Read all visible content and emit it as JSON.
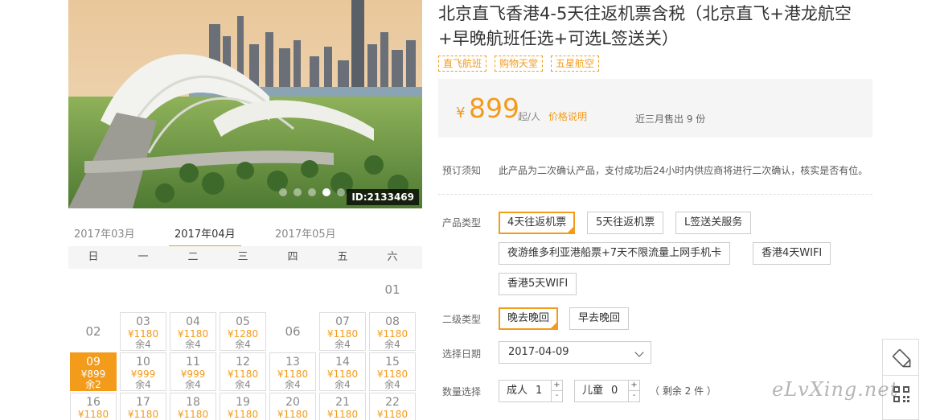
{
  "hero": {
    "image_id": "ID:2133469",
    "carousel_dots": 5,
    "active_dot": 4
  },
  "calendar": {
    "months": [
      "2017年03月",
      "2017年04月",
      "2017年05月"
    ],
    "active_month": "2017年04月",
    "weekdays": [
      "日",
      "一",
      "二",
      "三",
      "四",
      "五",
      "六"
    ],
    "weeks": [
      [
        {
          "d": ""
        },
        {
          "d": ""
        },
        {
          "d": ""
        },
        {
          "d": ""
        },
        {
          "d": ""
        },
        {
          "d": ""
        },
        {
          "d": "01"
        }
      ],
      [
        {
          "d": "02"
        },
        {
          "d": "03",
          "p": "¥1180",
          "r": "余4"
        },
        {
          "d": "04",
          "p": "¥1180",
          "r": "余4"
        },
        {
          "d": "05",
          "p": "¥1280",
          "r": "余4"
        },
        {
          "d": "06"
        },
        {
          "d": "07",
          "p": "¥1180",
          "r": "余4"
        },
        {
          "d": "08",
          "p": "¥1180",
          "r": "余4"
        }
      ],
      [
        {
          "d": "09",
          "p": "¥899",
          "r": "余2",
          "selected": true
        },
        {
          "d": "10",
          "p": "¥999",
          "r": "余4"
        },
        {
          "d": "11",
          "p": "¥999",
          "r": "余4"
        },
        {
          "d": "12",
          "p": "¥1180",
          "r": "余4"
        },
        {
          "d": "13",
          "p": "¥1180",
          "r": "余4"
        },
        {
          "d": "14",
          "p": "¥1180",
          "r": "余4"
        },
        {
          "d": "15",
          "p": "¥1180",
          "r": "余4"
        }
      ],
      [
        {
          "d": "16",
          "p": "¥1180"
        },
        {
          "d": "17",
          "p": "¥1180"
        },
        {
          "d": "18",
          "p": "¥1180"
        },
        {
          "d": "19",
          "p": "¥1180"
        },
        {
          "d": "20",
          "p": "¥1180"
        },
        {
          "d": "21",
          "p": "¥1180"
        },
        {
          "d": "22",
          "p": "¥1180"
        }
      ]
    ]
  },
  "product": {
    "title_line1": "北京直飞香港4-5天往返机票含税（北京直飞+港龙航空",
    "title_line2": "+早晚航班任选+可选L签送关）",
    "tags": [
      "直飞航班",
      "购物天堂",
      "五星航空"
    ]
  },
  "price": {
    "currency": "¥",
    "amount": "899",
    "unit": "起/人",
    "link": "价格说明",
    "sold": "近三月售出 9 份"
  },
  "booking": {
    "notice_label": "预订须知",
    "notice_text": "此产品为二次确认产品，支付成功后24小时内供应商将进行二次确认，核实是否有位。",
    "type_label": "产品类型",
    "types": [
      "4天往返机票",
      "5天往返机票",
      "L签送关服务",
      "夜游维多利亚港船票+7天不限流量上网手机卡",
      "香港4天WIFI",
      "香港5天WIFI"
    ],
    "selected_type": "4天往返机票",
    "subtype_label": "二级类型",
    "subtypes": [
      "晚去晚回",
      "早去晚回"
    ],
    "selected_subtype": "晚去晚回",
    "date_label": "选择日期",
    "date_value": "2017-04-09",
    "qty_label": "数量选择",
    "adult_label": "成人",
    "adult_value": "1",
    "child_label": "儿童",
    "child_value": "0",
    "plus": "+",
    "minus": "-",
    "remaining": "（ 剩余 2 件 ）"
  },
  "watermark": "eLvXing.net",
  "colors": {
    "accent": "#f39b1b",
    "panel": "#f5f5f5",
    "border": "#cccccc"
  },
  "icons": {
    "tool_1": "pencil-icon",
    "tool_2": "qrcode-icon"
  }
}
